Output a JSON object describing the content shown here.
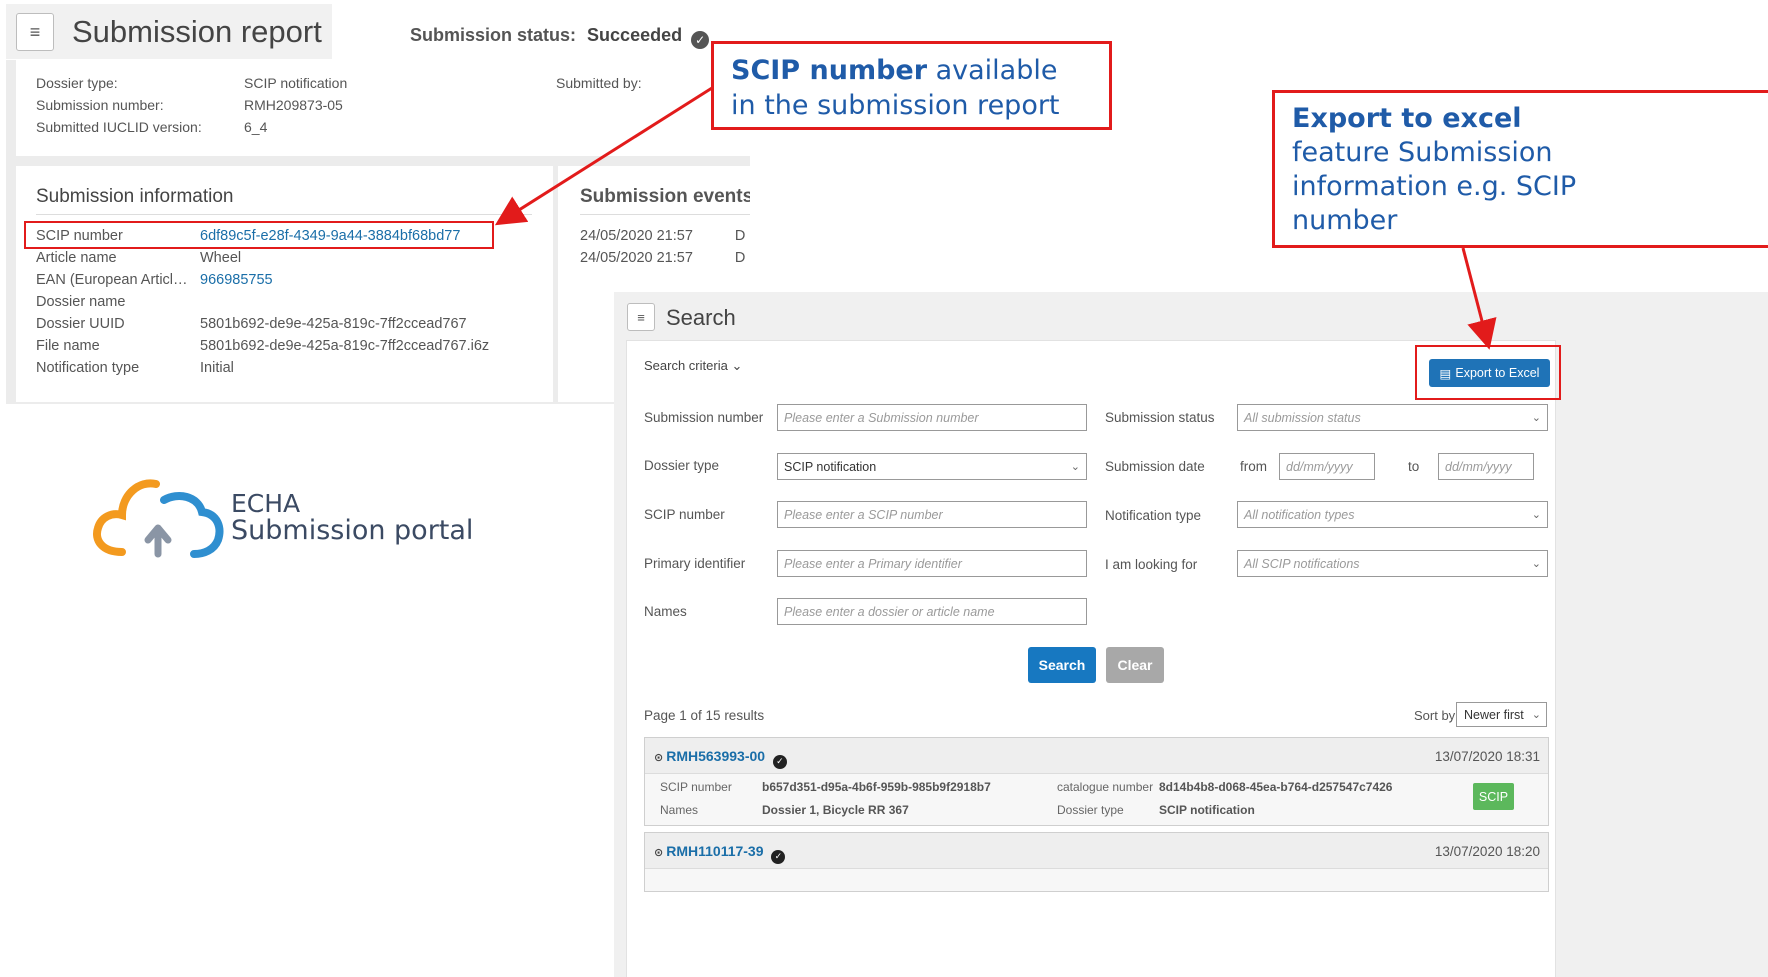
{
  "report": {
    "title": "Submission report",
    "menu_glyph": "≡",
    "status_label": "Submission status:",
    "status_value": "Succeeded",
    "check_glyph": "✓",
    "meta": [
      {
        "key": "Dossier type:",
        "value": "SCIP notification"
      },
      {
        "key": "Submission number:",
        "value": "RMH209873-05"
      },
      {
        "key": "Submitted IUCLID version:",
        "value": "6_4"
      }
    ],
    "submitted_by_label": "Submitted by:",
    "info_title": "Submission information",
    "info": [
      {
        "key": "SCIP number",
        "value": "6df89c5f-e28f-4349-9a44-3884bf68bd77"
      },
      {
        "key": "Article name",
        "value": "Wheel"
      },
      {
        "key": "EAN (European Article Number)",
        "value": "966985755"
      },
      {
        "key": "Dossier name",
        "value": ""
      },
      {
        "key": "Dossier UUID",
        "value": "5801b692-de9e-425a-819c-7ff2ccead767"
      },
      {
        "key": "File name",
        "value": "5801b692-de9e-425a-819c-7ff2ccead767.i6z"
      },
      {
        "key": "Notification type",
        "value": "Initial"
      }
    ],
    "events_title": "Submission events",
    "events": [
      {
        "time": "24/05/2020 21:57",
        "mark": "D"
      },
      {
        "time": "24/05/2020 21:57",
        "mark": "D"
      }
    ]
  },
  "callouts": {
    "scip_bold": "SCIP number",
    "scip_rest_1": " available",
    "scip_rest_2": "in the submission report",
    "export_bold": "Export to excel",
    "export_line2": "feature Submission",
    "export_line3": "information e.g. SCIP",
    "export_line4": "number"
  },
  "logo": {
    "line1": "ECHA",
    "line2": "Submission portal",
    "colors": {
      "orange": "#f39a1f",
      "blue": "#2f8fd0",
      "gray": "#8a95a5"
    }
  },
  "search": {
    "title": "Search",
    "menu_glyph": "≡",
    "criteria_label": "Search criteria",
    "chevron_glyph": "⌄",
    "export_label": "Export to Excel",
    "export_icon": "▤",
    "fields": {
      "submission_number": {
        "label": "Submission number",
        "placeholder": "Please enter a Submission number"
      },
      "submission_status": {
        "label": "Submission status",
        "placeholder": "All submission status"
      },
      "dossier_type": {
        "label": "Dossier type",
        "value": "SCIP notification"
      },
      "submission_date": {
        "label": "Submission date",
        "from": "from",
        "to": "to",
        "placeholder": "dd/mm/yyyy"
      },
      "scip_number": {
        "label": "SCIP number",
        "placeholder": "Please enter a SCIP number"
      },
      "notification_type": {
        "label": "Notification type",
        "placeholder": "All notification types"
      },
      "primary_identifier": {
        "label": "Primary identifier",
        "placeholder": "Please enter a Primary identifier"
      },
      "looking_for": {
        "label": "I am looking for",
        "placeholder": "All SCIP notifications"
      },
      "names": {
        "label": "Names",
        "placeholder": "Please enter a dossier or article name"
      }
    },
    "search_button": "Search",
    "clear_button": "Clear",
    "results_label": "Page 1 of 15 results",
    "sort_label": "Sort by",
    "sort_value": "Newer first",
    "results": [
      {
        "id": "RMH563993-00",
        "date": "13/07/2020 18:31",
        "scip_label": "SCIP number",
        "scip": "b657d351-d95a-4b6f-959b-985b9f2918b7",
        "names_label": "Names",
        "names": "Dossier 1, Bicycle RR 367",
        "catalogue_label": "catalogue number",
        "catalogue": "8d14b4b8-d068-45ea-b764-d257547c7426",
        "dossier_type_label": "Dossier type",
        "dossier_type": "SCIP notification",
        "badge": "SCIP"
      },
      {
        "id": "RMH110117-39",
        "date": "13/07/2020 18:20"
      }
    ],
    "colors": {
      "primary": "#1778c1",
      "badge": "#5cb85c",
      "callout_border": "#e21b1b",
      "callout_text": "#1f5ba8"
    }
  }
}
